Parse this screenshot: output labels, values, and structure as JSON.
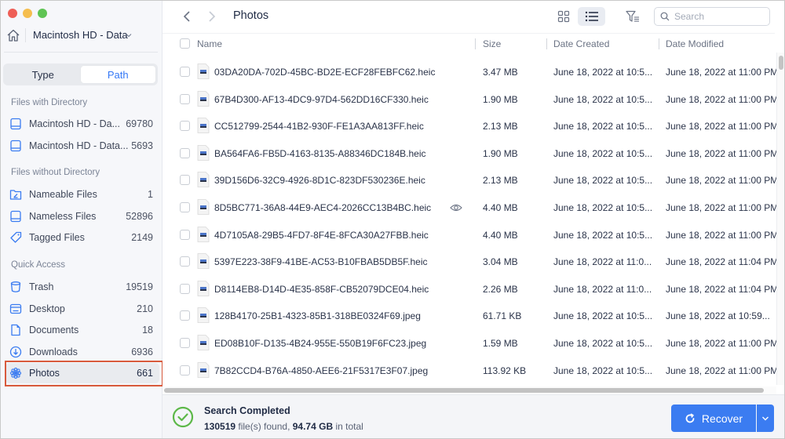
{
  "window": {
    "location": "Macintosh HD - Data",
    "title": "Photos"
  },
  "sidebar": {
    "tabs": [
      {
        "label": "Type",
        "active": false
      },
      {
        "label": "Path",
        "active": true
      }
    ],
    "sections": [
      {
        "title": "Files with Directory",
        "items": [
          {
            "icon": "drive-icon",
            "label": "Macintosh HD - Da...",
            "count": "69780"
          },
          {
            "icon": "drive-icon",
            "label": "Macintosh HD - Data...",
            "count": "5693"
          }
        ]
      },
      {
        "title": "Files without Directory",
        "items": [
          {
            "icon": "folder-edit-icon",
            "label": "Nameable Files",
            "count": "1"
          },
          {
            "icon": "drive-icon",
            "label": "Nameless Files",
            "count": "52896"
          },
          {
            "icon": "tag-icon",
            "label": "Tagged Files",
            "count": "2149"
          }
        ]
      },
      {
        "title": "Quick Access",
        "items": [
          {
            "icon": "trash-icon",
            "label": "Trash",
            "count": "19519"
          },
          {
            "icon": "desktop-icon",
            "label": "Desktop",
            "count": "210"
          },
          {
            "icon": "document-icon",
            "label": "Documents",
            "count": "18"
          },
          {
            "icon": "download-icon",
            "label": "Downloads",
            "count": "6936"
          },
          {
            "icon": "photos-icon",
            "label": "Photos",
            "count": "661",
            "selected": true
          }
        ]
      }
    ]
  },
  "toolbar": {
    "search_placeholder": "Search",
    "view_mode": "list"
  },
  "table": {
    "columns": [
      "Name",
      "Size",
      "Date Created",
      "Date Modified"
    ],
    "rows": [
      {
        "name": "03DA20DA-702D-45BC-BD2E-ECF28FEBFC62.heic",
        "size": "3.47 MB",
        "created": "June 18, 2022 at 10:5...",
        "modified": "June 18, 2022 at 11:00 PM"
      },
      {
        "name": "67B4D300-AF13-4DC9-97D4-562DD16CF330.heic",
        "size": "1.90 MB",
        "created": "June 18, 2022 at 10:5...",
        "modified": "June 18, 2022 at 11:00 PM"
      },
      {
        "name": "CC512799-2544-41B2-930F-FE1A3AA813FF.heic",
        "size": "2.13 MB",
        "created": "June 18, 2022 at 10:5...",
        "modified": "June 18, 2022 at 11:00 PM"
      },
      {
        "name": "BA564FA6-FB5D-4163-8135-A88346DC184B.heic",
        "size": "1.90 MB",
        "created": "June 18, 2022 at 10:5...",
        "modified": "June 18, 2022 at 11:00 PM"
      },
      {
        "name": "39D156D6-32C9-4926-8D1C-823DF530236E.heic",
        "size": "2.13 MB",
        "created": "June 18, 2022 at 10:5...",
        "modified": "June 18, 2022 at 11:00 PM"
      },
      {
        "name": "8D5BC771-36A8-44E9-AEC4-2026CC13B4BC.heic",
        "size": "4.40 MB",
        "created": "June 18, 2022 at 10:5...",
        "modified": "June 18, 2022 at 11:00 PM",
        "preview": true
      },
      {
        "name": "4D7105A8-29B5-4FD7-8F4E-8FCA30A27FBB.heic",
        "size": "4.40 MB",
        "created": "June 18, 2022 at 10:5...",
        "modified": "June 18, 2022 at 11:00 PM"
      },
      {
        "name": "5397E223-38F9-41BE-AC53-B10FBAB5DB5F.heic",
        "size": "3.04 MB",
        "created": "June 18, 2022 at 11:0...",
        "modified": "June 18, 2022 at 11:04 PM"
      },
      {
        "name": "D8114EB8-D14D-4E35-858F-CB52079DCE04.heic",
        "size": "2.26 MB",
        "created": "June 18, 2022 at 11:0...",
        "modified": "June 18, 2022 at 11:04 PM"
      },
      {
        "name": "128B4170-25B1-4323-85B1-318BE0324F69.jpeg",
        "size": "61.71 KB",
        "created": "June 18, 2022 at 10:5...",
        "modified": "June 18, 2022 at 10:59..."
      },
      {
        "name": "ED08B10F-D135-4B24-955E-550B19F6FC23.jpeg",
        "size": "1.59 MB",
        "created": "June 18, 2022 at 10:5...",
        "modified": "June 18, 2022 at 11:00 PM"
      },
      {
        "name": "7B82CCD4-B76A-4850-AEE6-21F5317E3F07.jpeg",
        "size": "113.92 KB",
        "created": "June 18, 2022 at 10:5...",
        "modified": "June 18, 2022 at 11:00 PM"
      }
    ]
  },
  "status": {
    "title": "Search Completed",
    "file_count": "130519",
    "files_text": " file(s) found, ",
    "total_size": "94.74 GB",
    "total_text": " in total"
  },
  "actions": {
    "recover_label": "Recover"
  },
  "colors": {
    "accent": "#3b7cf1",
    "success": "#5cb848",
    "highlight": "#d85a3c"
  }
}
